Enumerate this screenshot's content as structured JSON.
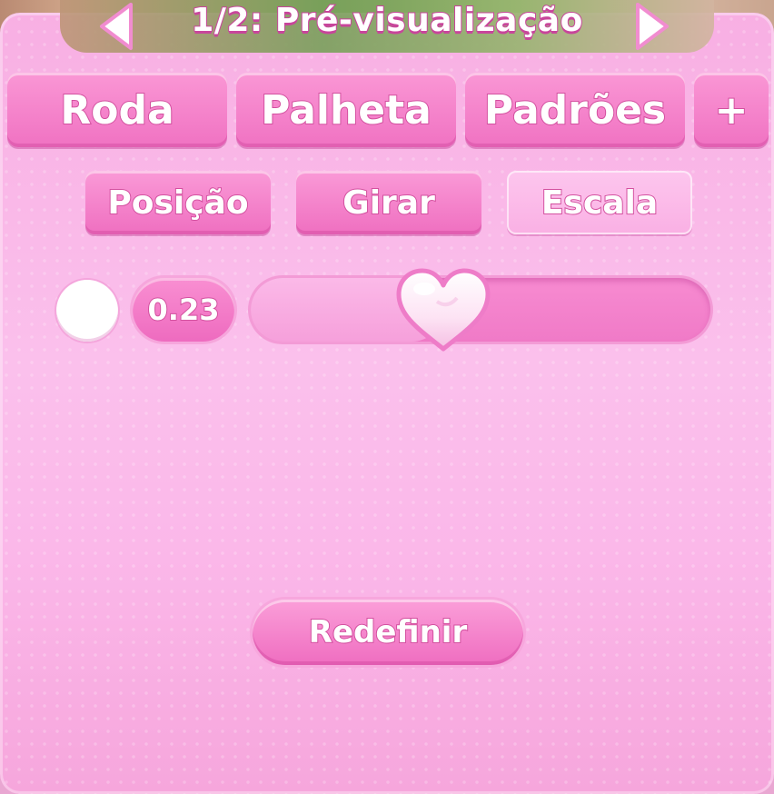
{
  "header": {
    "title": "1/2: Pré-visualização",
    "prev_icon": "chevron-left-icon",
    "next_icon": "chevron-right-icon"
  },
  "tabs": [
    {
      "label": "Roda"
    },
    {
      "label": "Palheta"
    },
    {
      "label": "Padrões"
    },
    {
      "label": "+"
    }
  ],
  "subtabs": [
    {
      "label": "Posição",
      "active": false
    },
    {
      "label": "Girar",
      "active": false
    },
    {
      "label": "Escala",
      "active": true
    }
  ],
  "scale_control": {
    "color_preview": "#ffffff",
    "value_label": "0.23",
    "slider_value": 0.23,
    "knob_icon": "heart-icon"
  },
  "actions": {
    "reset_label": "Redefinir"
  },
  "colors": {
    "accent": "#f072c2",
    "panel": "#f9b6e6",
    "text_outline": "#d3509f"
  }
}
